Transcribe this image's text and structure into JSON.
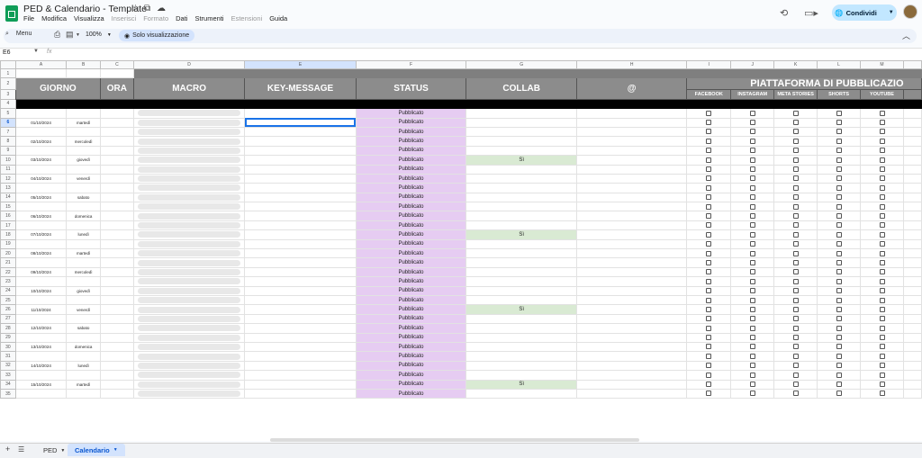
{
  "app": {
    "title": "PED & Calendario - Template",
    "menus": [
      {
        "label": "File",
        "enabled": true
      },
      {
        "label": "Modifica",
        "enabled": true
      },
      {
        "label": "Visualizza",
        "enabled": true
      },
      {
        "label": "Inserisci",
        "enabled": false
      },
      {
        "label": "Formato",
        "enabled": false
      },
      {
        "label": "Dati",
        "enabled": true
      },
      {
        "label": "Strumenti",
        "enabled": true
      },
      {
        "label": "Estensioni",
        "enabled": false
      },
      {
        "label": "Guida",
        "enabled": true
      }
    ],
    "share_label": "Condividi"
  },
  "toolbar": {
    "menu_label": "Menu",
    "zoom": "100%",
    "view_only_label": "Solo visualizzazione"
  },
  "formula": {
    "cell_ref": "E6",
    "fx": "fx"
  },
  "grid": {
    "columns": [
      "A",
      "B",
      "C",
      "D",
      "E",
      "F",
      "G",
      "H",
      "I",
      "J",
      "K",
      "L",
      "M"
    ],
    "selected_column": "E",
    "selected_row": 6,
    "headers": {
      "giorno": "GIORNO",
      "ora": "ORA",
      "macro": "MACRO",
      "key_message": "KEY-MESSAGE",
      "status": "STATUS",
      "collab": "COLLAB",
      "at": "@",
      "platform": "PIATTAFORMA DI PUBBLICAZIO",
      "platforms": [
        "FACEBOOK",
        "INSTAGRAM",
        "META STORIES",
        "SHORTS",
        "YOUTUBE"
      ]
    },
    "rows": [
      {
        "n": 5,
        "date": "",
        "day": "",
        "status": "Pubblicato",
        "collab": ""
      },
      {
        "n": 6,
        "date": "01/10/2024",
        "day": "martedì",
        "status": "Pubblicato",
        "collab": ""
      },
      {
        "n": 7,
        "date": "",
        "day": "",
        "status": "Pubblicato",
        "collab": ""
      },
      {
        "n": 8,
        "date": "02/10/2024",
        "day": "mercoledì",
        "status": "Pubblicato",
        "collab": ""
      },
      {
        "n": 9,
        "date": "",
        "day": "",
        "status": "Pubblicato",
        "collab": ""
      },
      {
        "n": 10,
        "date": "03/10/2024",
        "day": "giovedì",
        "status": "Pubblicato",
        "collab": "Sì"
      },
      {
        "n": 11,
        "date": "",
        "day": "",
        "status": "Pubblicato",
        "collab": ""
      },
      {
        "n": 12,
        "date": "04/10/2024",
        "day": "venerdì",
        "status": "Pubblicato",
        "collab": ""
      },
      {
        "n": 13,
        "date": "",
        "day": "",
        "status": "Pubblicato",
        "collab": ""
      },
      {
        "n": 14,
        "date": "05/10/2024",
        "day": "sabato",
        "status": "Pubblicato",
        "collab": ""
      },
      {
        "n": 15,
        "date": "",
        "day": "",
        "status": "Pubblicato",
        "collab": ""
      },
      {
        "n": 16,
        "date": "06/10/2024",
        "day": "domenica",
        "status": "Pubblicato",
        "collab": ""
      },
      {
        "n": 17,
        "date": "",
        "day": "",
        "status": "Pubblicato",
        "collab": ""
      },
      {
        "n": 18,
        "date": "07/10/2024",
        "day": "lunedì",
        "status": "Pubblicato",
        "collab": "Sì"
      },
      {
        "n": 19,
        "date": "",
        "day": "",
        "status": "Pubblicato",
        "collab": ""
      },
      {
        "n": 20,
        "date": "08/10/2024",
        "day": "martedì",
        "status": "Pubblicato",
        "collab": ""
      },
      {
        "n": 21,
        "date": "",
        "day": "",
        "status": "Pubblicato",
        "collab": ""
      },
      {
        "n": 22,
        "date": "09/10/2024",
        "day": "mercoledì",
        "status": "Pubblicato",
        "collab": ""
      },
      {
        "n": 23,
        "date": "",
        "day": "",
        "status": "Pubblicato",
        "collab": ""
      },
      {
        "n": 24,
        "date": "10/10/2024",
        "day": "giovedì",
        "status": "Pubblicato",
        "collab": ""
      },
      {
        "n": 25,
        "date": "",
        "day": "",
        "status": "Pubblicato",
        "collab": ""
      },
      {
        "n": 26,
        "date": "11/10/2024",
        "day": "venerdì",
        "status": "Pubblicato",
        "collab": "Sì"
      },
      {
        "n": 27,
        "date": "",
        "day": "",
        "status": "Pubblicato",
        "collab": ""
      },
      {
        "n": 28,
        "date": "12/10/2024",
        "day": "sabato",
        "status": "Pubblicato",
        "collab": ""
      },
      {
        "n": 29,
        "date": "",
        "day": "",
        "status": "Pubblicato",
        "collab": ""
      },
      {
        "n": 30,
        "date": "13/10/2024",
        "day": "domenica",
        "status": "Pubblicato",
        "collab": ""
      },
      {
        "n": 31,
        "date": "",
        "day": "",
        "status": "Pubblicato",
        "collab": ""
      },
      {
        "n": 32,
        "date": "14/10/2024",
        "day": "lunedì",
        "status": "Pubblicato",
        "collab": ""
      },
      {
        "n": 33,
        "date": "",
        "day": "",
        "status": "Pubblicato",
        "collab": ""
      },
      {
        "n": 34,
        "date": "15/10/2024",
        "day": "martedì",
        "status": "Pubblicato",
        "collab": "Sì"
      },
      {
        "n": 35,
        "date": "",
        "day": "",
        "status": "Pubblicato",
        "collab": ""
      }
    ]
  },
  "sheets": {
    "tabs": [
      {
        "label": "PED",
        "active": false
      },
      {
        "label": "Calendario",
        "active": true
      }
    ]
  },
  "colors": {
    "status_bg": "#e6ccf2",
    "collab_bg": "#d9ead3",
    "header_bg": "#8c8c8c",
    "share_bg": "#c2e7ff"
  },
  "icons": [
    "sheets-logo-icon",
    "star-icon",
    "move-icon",
    "cloud-icon",
    "history-icon",
    "video-icon",
    "globe-icon",
    "search-icon",
    "print-icon",
    "paint-format-icon",
    "eye-icon",
    "chevron-up-icon",
    "sheets-list-icon"
  ]
}
